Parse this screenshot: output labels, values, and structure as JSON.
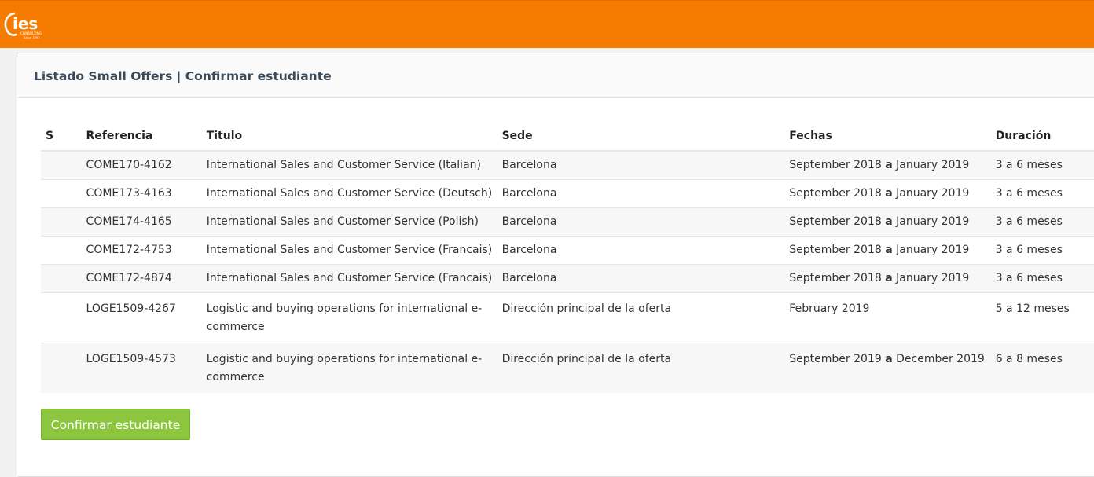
{
  "brand": {
    "logo_text": "ies",
    "logo_sub": "CONSULTING",
    "logo_since": "Since 1997",
    "header_color": "#f57c00"
  },
  "panel": {
    "title": "Listado Small Offers | Confirmar estudiante"
  },
  "table": {
    "headers": {
      "s": "S",
      "referencia": "Referencia",
      "titulo": "Titulo",
      "sede": "Sede",
      "fechas": "Fechas",
      "duracion": "Duración"
    },
    "rows": [
      {
        "ref": "COME170-4162",
        "titulo": "International Sales and Customer Service (Italian)",
        "sede": "Barcelona",
        "desde": "September 2018",
        "sep": "a",
        "hasta": "January 2019",
        "duracion": "3 a 6 meses"
      },
      {
        "ref": "COME173-4163",
        "titulo": "International Sales and Customer Service (Deutsch)",
        "sede": "Barcelona",
        "desde": "September 2018",
        "sep": "a",
        "hasta": "January 2019",
        "duracion": "3 a 6 meses"
      },
      {
        "ref": "COME174-4165",
        "titulo": "International Sales and Customer Service (Polish)",
        "sede": "Barcelona",
        "desde": "September 2018",
        "sep": "a",
        "hasta": "January 2019",
        "duracion": "3 a 6 meses"
      },
      {
        "ref": "COME172-4753",
        "titulo": "International Sales and Customer Service (Francais)",
        "sede": "Barcelona",
        "desde": "September 2018",
        "sep": "a",
        "hasta": "January 2019",
        "duracion": "3 a 6 meses"
      },
      {
        "ref": "COME172-4874",
        "titulo": "International Sales and Customer Service (Francais)",
        "sede": "Barcelona",
        "desde": "September 2018",
        "sep": "a",
        "hasta": "January 2019",
        "duracion": "3 a 6 meses"
      },
      {
        "ref": "LOGE1509-4267",
        "titulo": "Logistic and buying operations for international e-commerce",
        "sede": "Dirección principal de la oferta",
        "desde": "February 2019",
        "sep": "",
        "hasta": "",
        "duracion": "5 a 12 meses"
      },
      {
        "ref": "LOGE1509-4573",
        "titulo": "Logistic and buying operations for international e-commerce",
        "sede": "Dirección principal de la oferta",
        "desde": "September 2019",
        "sep": "a",
        "hasta": "December 2019",
        "duracion": "6 a 8 meses"
      }
    ]
  },
  "actions": {
    "confirm_label": "Confirmar estudiante",
    "confirm_color": "#8cc63f"
  }
}
